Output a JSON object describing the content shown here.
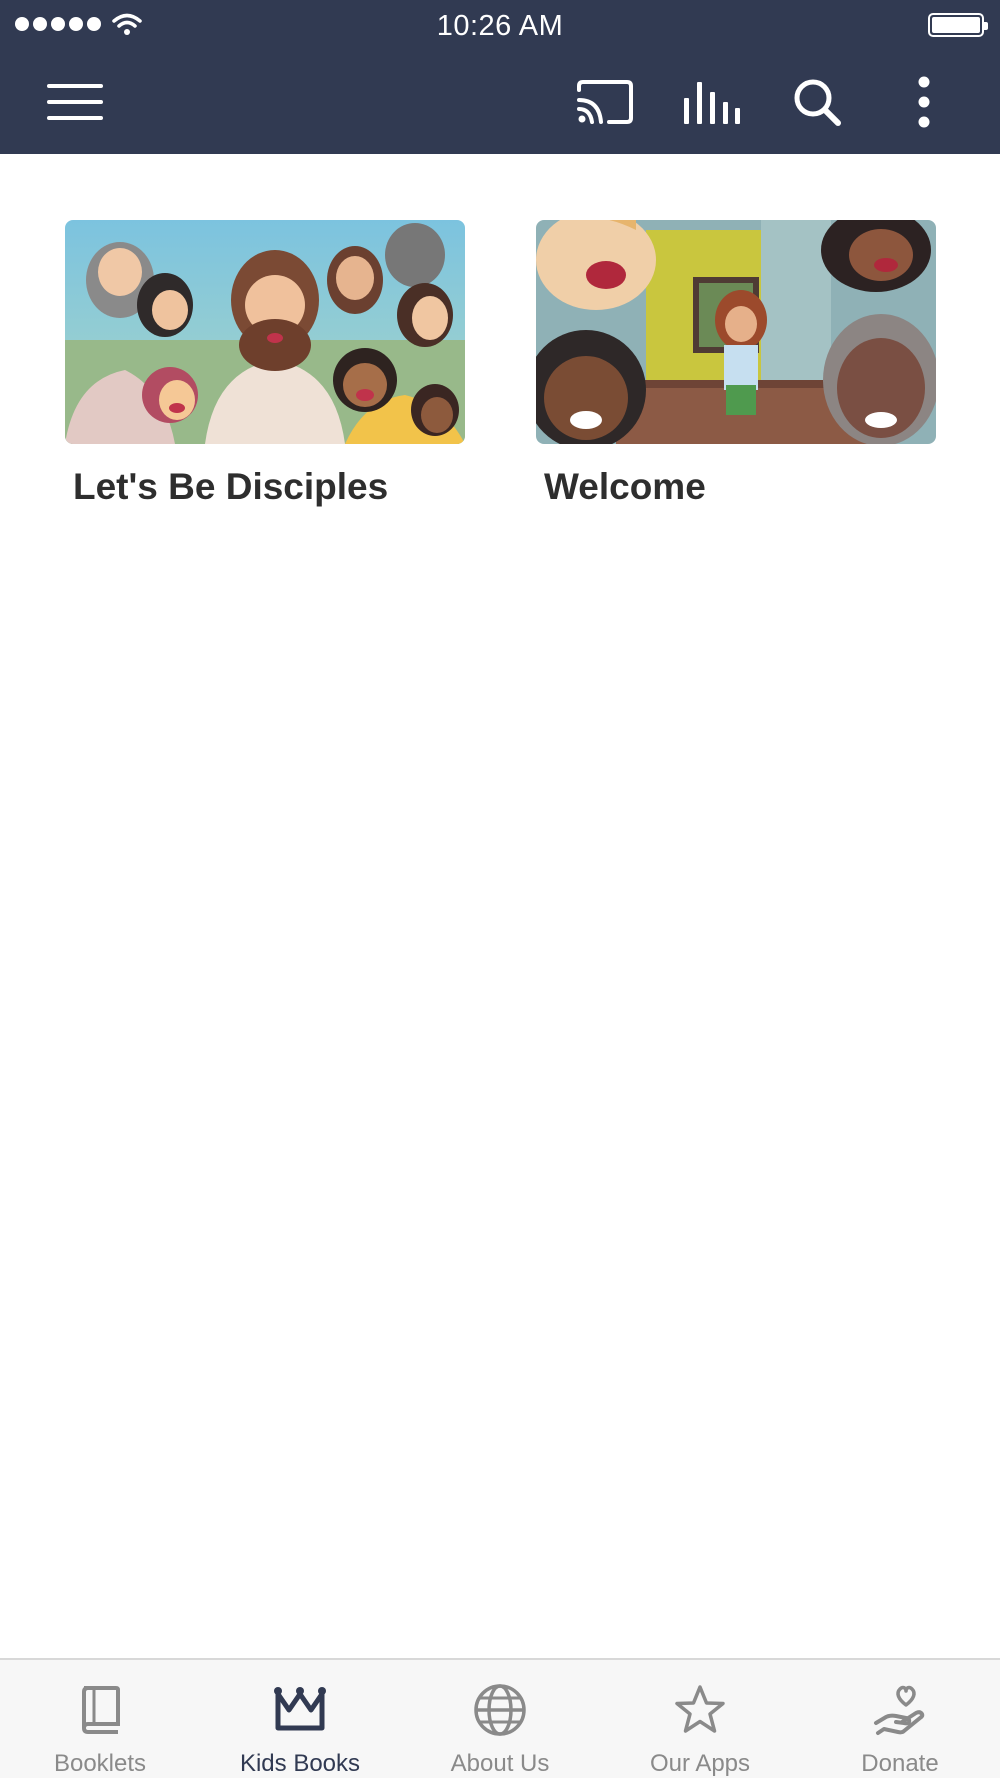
{
  "status_bar": {
    "time": "10:26 AM"
  },
  "colors": {
    "header": "#313a52",
    "accent": "#313a52",
    "inactive": "#8a8a8a"
  },
  "toolbar": {
    "icons": [
      "menu-icon",
      "cast-icon",
      "equalizer-icon",
      "search-icon",
      "more-vertical-icon"
    ]
  },
  "cards": [
    {
      "title": "Let's Be Disciples"
    },
    {
      "title": "Welcome"
    }
  ],
  "bottom_nav": {
    "active": "Kids Books",
    "items": [
      {
        "label": "Booklets",
        "icon": "book-icon"
      },
      {
        "label": "Kids Books",
        "icon": "crown-icon"
      },
      {
        "label": "About Us",
        "icon": "globe-icon"
      },
      {
        "label": "Our Apps",
        "icon": "star-icon"
      },
      {
        "label": "Donate",
        "icon": "donate-heart-hand-icon"
      }
    ]
  }
}
